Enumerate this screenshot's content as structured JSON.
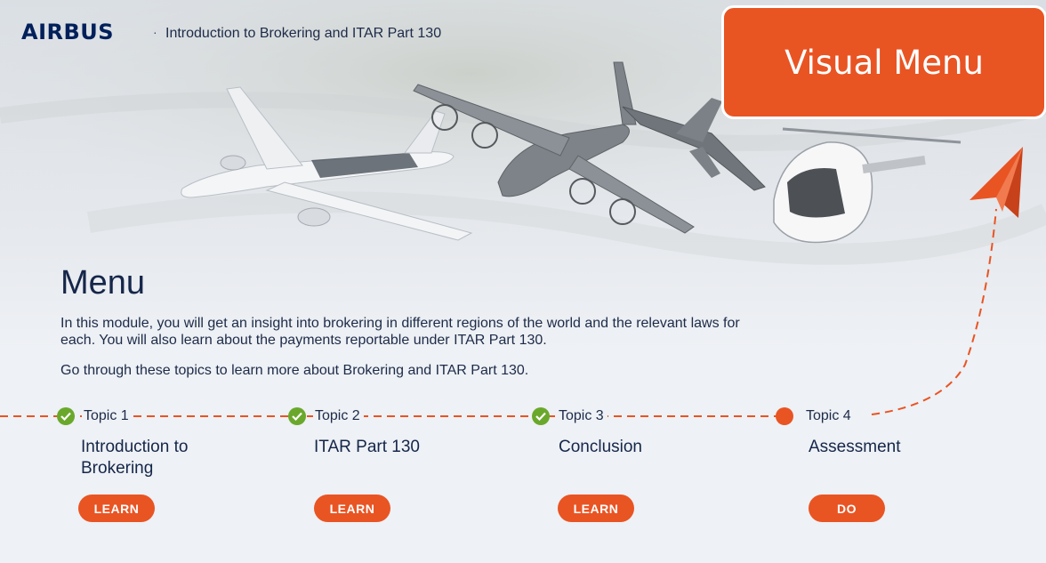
{
  "header": {
    "logo": "AIRBUS",
    "separator": "·",
    "course_title": "Introduction to Brokering and ITAR Part 130"
  },
  "overlay": {
    "label": "Visual Menu"
  },
  "menu": {
    "heading": "Menu",
    "intro": "In this module, you will get an insight into brokering in different regions of the world and the relevant laws for each. You will also learn about the payments reportable under ITAR Part 130.",
    "cta": "Go through these topics to learn more about Brokering and ITAR Part 130."
  },
  "topics": [
    {
      "label": "Topic 1",
      "title": "Introduction to Brokering",
      "button": "LEARN",
      "status": "complete",
      "icon": "check-icon"
    },
    {
      "label": "Topic 2",
      "title": "ITAR Part 130",
      "button": "LEARN",
      "status": "complete",
      "icon": "check-icon"
    },
    {
      "label": "Topic 3",
      "title": "Conclusion",
      "button": "LEARN",
      "status": "complete",
      "icon": "check-icon"
    },
    {
      "label": "Topic 4",
      "title": "Assessment",
      "button": "DO",
      "status": "current",
      "icon": "dot-icon"
    }
  ],
  "colors": {
    "accent": "#e95423",
    "complete": "#6aa82c",
    "text": "#1d2b49",
    "brand": "#00205b"
  }
}
